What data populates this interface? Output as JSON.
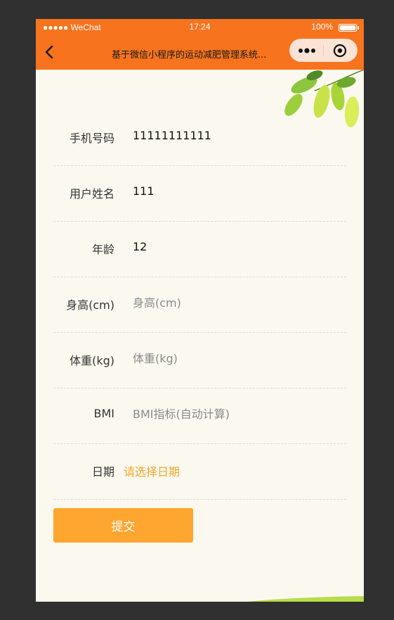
{
  "status_bar": {
    "carrier": "●●●●● WeChat",
    "time": "17:24",
    "battery": "100%"
  },
  "nav": {
    "title": "基于微信小程序的运动减肥管理系统..."
  },
  "form": {
    "phone": {
      "label": "手机号码",
      "value": "11111111111"
    },
    "name": {
      "label": "用户姓名",
      "value": "111"
    },
    "age": {
      "label": "年龄",
      "value": "12"
    },
    "height": {
      "label": "身高(cm)",
      "placeholder": "身高(cm)"
    },
    "weight": {
      "label": "体重(kg)",
      "placeholder": "体重(kg)"
    },
    "bmi": {
      "label": "BMI",
      "placeholder": "BMI指标(自动计算)"
    },
    "date": {
      "label": "日期",
      "placeholder": "请选择日期"
    }
  },
  "submit_label": "提交",
  "colors": {
    "nav_bg": "#f7731e",
    "page_bg": "#fbf9ef",
    "accent": "#ffa630",
    "date_text": "#f0a630"
  }
}
